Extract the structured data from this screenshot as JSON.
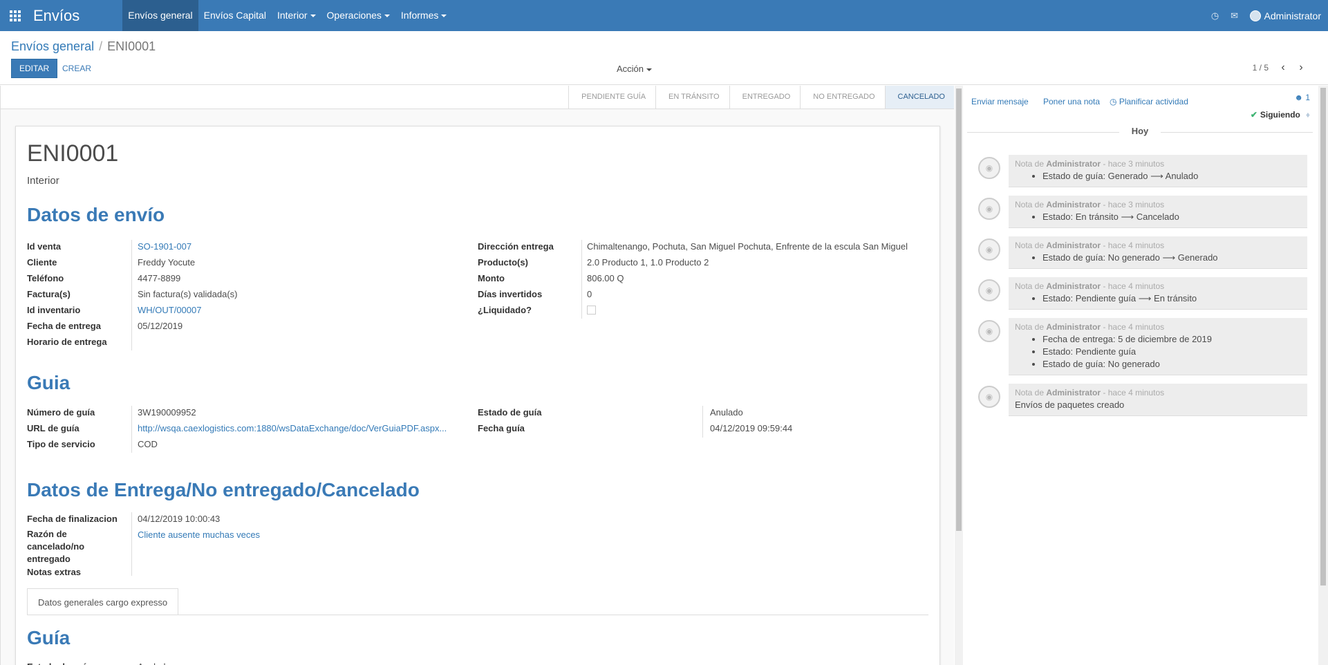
{
  "navbar": {
    "brand": "Envíos",
    "menu": [
      {
        "label": "Envíos general",
        "active": true,
        "dropdown": false
      },
      {
        "label": "Envíos Capital",
        "active": false,
        "dropdown": false
      },
      {
        "label": "Interior",
        "active": false,
        "dropdown": true
      },
      {
        "label": "Operaciones",
        "active": false,
        "dropdown": true
      },
      {
        "label": "Informes",
        "active": false,
        "dropdown": true
      }
    ],
    "user": "Administrator",
    "icons": [
      "clock-icon",
      "chat-icon"
    ]
  },
  "control": {
    "breadcrumb_parent": "Envíos general",
    "breadcrumb_current": "ENI0001",
    "edit_label": "EDITAR",
    "create_label": "CREAR",
    "action_label": "Acción",
    "pager": "1 / 5"
  },
  "statusbar": {
    "stages": [
      "PENDIENTE GUÍA",
      "EN TRÁNSITO",
      "ENTREGADO",
      "NO ENTREGADO",
      "CANCELADO"
    ],
    "current": "CANCELADO"
  },
  "record": {
    "name": "ENI0001",
    "type": "Interior",
    "section_shipping": "Datos de envío",
    "shipping_left": [
      {
        "label": "Id venta",
        "value": "SO-1901-007",
        "link": true
      },
      {
        "label": "Cliente",
        "value": "Freddy Yocute",
        "link": false
      },
      {
        "label": "Teléfono",
        "value": "4477-8899",
        "link": false
      },
      {
        "label": "Factura(s)",
        "value": "Sin factura(s) validada(s)",
        "link": false
      },
      {
        "label": "Id inventario",
        "value": "WH/OUT/00007",
        "link": true
      },
      {
        "label": "Fecha de entrega",
        "value": "05/12/2019",
        "link": false
      },
      {
        "label": "Horario de entrega",
        "value": "",
        "link": false
      }
    ],
    "shipping_right": [
      {
        "label": "Dirección entrega",
        "value": "Chimaltenango, Pochuta, San Miguel Pochuta, Enfrente de la escula San Miguel"
      },
      {
        "label": "Producto(s)",
        "value": "2.0 Producto 1, 1.0 Producto 2"
      },
      {
        "label": "Monto",
        "value": "806.00 Q"
      },
      {
        "label": "Días invertidos",
        "value": "0"
      },
      {
        "label": "¿Liquidado?",
        "value": ""
      }
    ],
    "section_guide": "Guia",
    "guide_left": [
      {
        "label": "Número de guía",
        "value": "3W190009952",
        "link": false
      },
      {
        "label": "URL de guía",
        "value": "http://wsqa.caexlogistics.com:1880/wsDataExchange/doc/VerGuiaPDF.aspx...",
        "link": true
      },
      {
        "label": "Tipo de servicio",
        "value": "COD",
        "link": false
      }
    ],
    "guide_right": [
      {
        "label": "Estado de guía",
        "value": "Anulado"
      },
      {
        "label": "Fecha guía",
        "value": "04/12/2019 09:59:44"
      }
    ],
    "section_delivery": "Datos de Entrega/No entregado/Cancelado",
    "delivery": [
      {
        "label": "Fecha de finalizacion",
        "value": "04/12/2019 10:00:43",
        "link": false
      },
      {
        "label": "Razón de cancelado/no entregado",
        "value": "Cliente ausente muchas veces",
        "link": true
      },
      {
        "label": "Notas extras",
        "value": "",
        "link": false
      }
    ],
    "tab_label": "Datos generales cargo expresso",
    "section_guide2": "Guía",
    "guide2_label": "Estado de guía",
    "guide2_value": "Anulado"
  },
  "chatter": {
    "send_message": "Enviar mensaje",
    "log_note": "Poner una nota",
    "schedule_activity": "Planificar actividad",
    "followers_count": "1",
    "following": "Siguiendo",
    "day": "Hoy",
    "messages": [
      {
        "prefix": "Nota de",
        "author": "Administrator",
        "time": "- hace 3 minutos",
        "lines": [
          "Estado de guía: Generado ⟶ Anulado"
        ]
      },
      {
        "prefix": "Nota de",
        "author": "Administrator",
        "time": "- hace 3 minutos",
        "lines": [
          "Estado: En tránsito ⟶ Cancelado"
        ]
      },
      {
        "prefix": "Nota de",
        "author": "Administrator",
        "time": "- hace 4 minutos",
        "lines": [
          "Estado de guía: No generado ⟶ Generado"
        ]
      },
      {
        "prefix": "Nota de",
        "author": "Administrator",
        "time": "- hace 4 minutos",
        "lines": [
          "Estado: Pendiente guía ⟶ En tránsito"
        ]
      },
      {
        "prefix": "Nota de",
        "author": "Administrator",
        "time": "- hace 4 minutos",
        "lines": [
          "Fecha de entrega: 5 de diciembre de 2019",
          "Estado: Pendiente guía",
          "Estado de guía: No generado"
        ]
      },
      {
        "prefix": "Nota de",
        "author": "Administrator",
        "time": "- hace 4 minutos",
        "plain": "Envíos de paquetes creado"
      }
    ]
  }
}
